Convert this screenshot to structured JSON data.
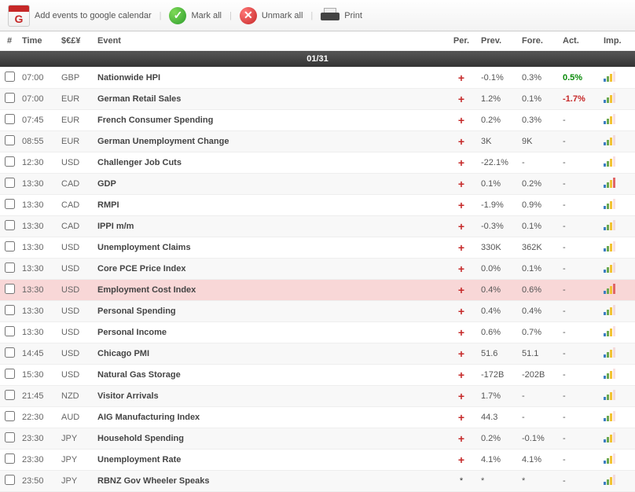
{
  "toolbar": {
    "google_cal": "Add events to google calendar",
    "mark_all": "Mark all",
    "unmark_all": "Unmark all",
    "print": "Print"
  },
  "headers": {
    "num": "#",
    "time": "Time",
    "curr": "$€£¥",
    "event": "Event",
    "per": "Per.",
    "prev": "Prev.",
    "fore": "Fore.",
    "act": "Act.",
    "imp": "Imp."
  },
  "date_header": "01/31",
  "rows": [
    {
      "time": "07:00",
      "curr": "GBP",
      "event": "Nationwide HPI",
      "per": "plus",
      "prev": "-0.1%",
      "fore": "0.3%",
      "act": "0.5%",
      "act_class": "pos",
      "imp": 3
    },
    {
      "time": "07:00",
      "curr": "EUR",
      "event": "German Retail Sales",
      "per": "plus",
      "prev": "1.2%",
      "fore": "0.1%",
      "act": "-1.7%",
      "act_class": "neg",
      "imp": 3
    },
    {
      "time": "07:45",
      "curr": "EUR",
      "event": "French Consumer Spending",
      "per": "plus",
      "prev": "0.2%",
      "fore": "0.3%",
      "act": "-",
      "imp": 3
    },
    {
      "time": "08:55",
      "curr": "EUR",
      "event": "German Unemployment Change",
      "per": "plus",
      "prev": "3K",
      "fore": "9K",
      "act": "-",
      "imp": 3
    },
    {
      "time": "12:30",
      "curr": "USD",
      "event": "Challenger Job Cuts",
      "per": "plus",
      "prev": "-22.1%",
      "fore": "-",
      "act": "-",
      "imp": 3
    },
    {
      "time": "13:30",
      "curr": "CAD",
      "event": "GDP",
      "per": "plus",
      "prev": "0.1%",
      "fore": "0.2%",
      "act": "-",
      "imp": 4
    },
    {
      "time": "13:30",
      "curr": "CAD",
      "event": "RMPI",
      "per": "plus",
      "prev": "-1.9%",
      "fore": "0.9%",
      "act": "-",
      "imp": 3
    },
    {
      "time": "13:30",
      "curr": "CAD",
      "event": "IPPI m/m",
      "per": "plus",
      "prev": "-0.3%",
      "fore": "0.1%",
      "act": "-",
      "imp": 3
    },
    {
      "time": "13:30",
      "curr": "USD",
      "event": "Unemployment Claims",
      "per": "plus",
      "prev": "330K",
      "fore": "362K",
      "act": "-",
      "imp": 3
    },
    {
      "time": "13:30",
      "curr": "USD",
      "event": "Core PCE Price Index",
      "per": "plus",
      "prev": "0.0%",
      "fore": "0.1%",
      "act": "-",
      "imp": 3
    },
    {
      "time": "13:30",
      "curr": "USD",
      "event": "Employment Cost Index",
      "per": "plus",
      "prev": "0.4%",
      "fore": "0.6%",
      "act": "-",
      "imp": 4,
      "highlight": true
    },
    {
      "time": "13:30",
      "curr": "USD",
      "event": "Personal Spending",
      "per": "plus",
      "prev": "0.4%",
      "fore": "0.4%",
      "act": "-",
      "imp": 3
    },
    {
      "time": "13:30",
      "curr": "USD",
      "event": "Personal Income",
      "per": "plus",
      "prev": "0.6%",
      "fore": "0.7%",
      "act": "-",
      "imp": 3
    },
    {
      "time": "14:45",
      "curr": "USD",
      "event": "Chicago PMI",
      "per": "plus",
      "prev": "51.6",
      "fore": "51.1",
      "act": "-",
      "imp": 3
    },
    {
      "time": "15:30",
      "curr": "USD",
      "event": "Natural Gas Storage",
      "per": "plus",
      "prev": "-172B",
      "fore": "-202B",
      "act": "-",
      "imp": 3
    },
    {
      "time": "21:45",
      "curr": "NZD",
      "event": "Visitor Arrivals",
      "per": "plus",
      "prev": "1.7%",
      "fore": "-",
      "act": "-",
      "imp": 3
    },
    {
      "time": "22:30",
      "curr": "AUD",
      "event": "AIG Manufacturing Index",
      "per": "plus",
      "prev": "44.3",
      "fore": "-",
      "act": "-",
      "imp": 3
    },
    {
      "time": "23:30",
      "curr": "JPY",
      "event": "Household Spending",
      "per": "plus",
      "prev": "0.2%",
      "fore": "-0.1%",
      "act": "-",
      "imp": 3
    },
    {
      "time": "23:30",
      "curr": "JPY",
      "event": "Unemployment Rate",
      "per": "plus",
      "prev": "4.1%",
      "fore": "4.1%",
      "act": "-",
      "imp": 3
    },
    {
      "time": "23:50",
      "curr": "JPY",
      "event": "RBNZ Gov Wheeler Speaks",
      "per": "star",
      "prev": "*",
      "fore": "*",
      "act": "-",
      "imp": 3
    }
  ]
}
